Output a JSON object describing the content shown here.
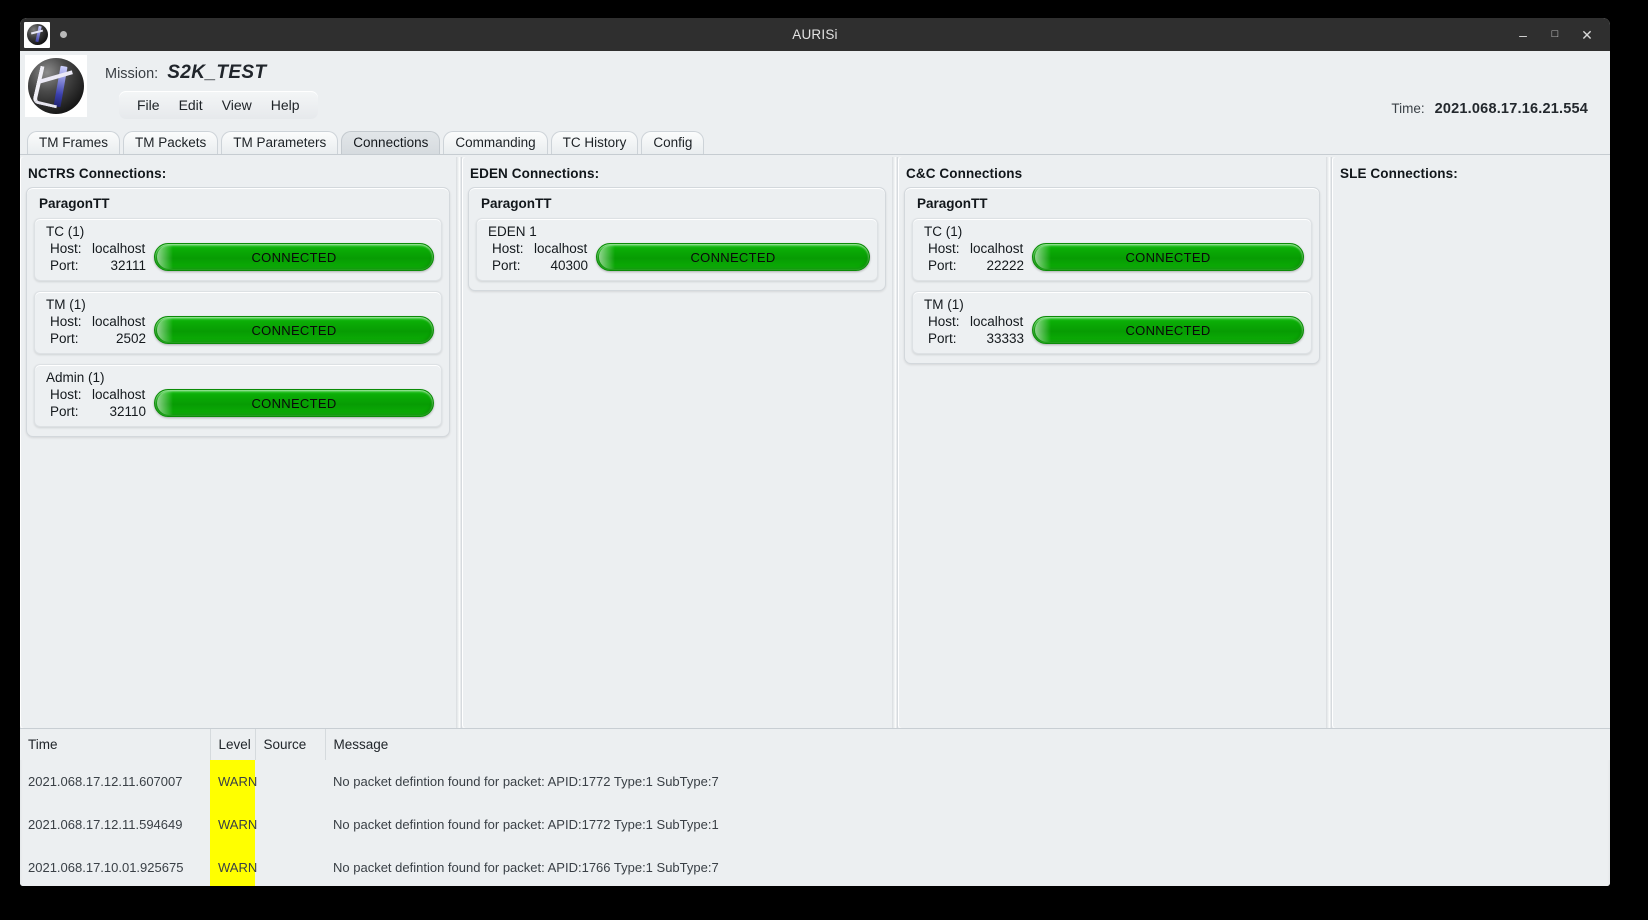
{
  "window": {
    "title": "AURISi",
    "minimize_icon": "minimize-icon",
    "maximize_icon": "maximize-icon",
    "close_icon": "close-icon",
    "minimize_glyph": "–",
    "maximize_glyph": "□",
    "close_glyph": "✕"
  },
  "header": {
    "mission_label": "Mission:",
    "mission_value": "S2K_TEST",
    "time_label": "Time:",
    "time_value": "2021.068.17.16.21.554",
    "menu": [
      {
        "label": "File"
      },
      {
        "label": "Edit"
      },
      {
        "label": "View"
      },
      {
        "label": "Help"
      }
    ]
  },
  "tabs": [
    {
      "label": "TM Frames",
      "active": false
    },
    {
      "label": "TM Packets",
      "active": false
    },
    {
      "label": "TM Parameters",
      "active": false
    },
    {
      "label": "Connections",
      "active": true
    },
    {
      "label": "Commanding",
      "active": false
    },
    {
      "label": "TC History",
      "active": false
    },
    {
      "label": "Config",
      "active": false
    }
  ],
  "panels": {
    "nctrs": {
      "title": "NCTRS Connections:",
      "group": "ParagonTT",
      "connections": [
        {
          "name": "TC (1)",
          "host_label": "Host:",
          "host": "localhost",
          "port_label": "Port:",
          "port": "32111",
          "status": "CONNECTED"
        },
        {
          "name": "TM (1)",
          "host_label": "Host:",
          "host": "localhost",
          "port_label": "Port:",
          "port": "2502",
          "status": "CONNECTED"
        },
        {
          "name": "Admin (1)",
          "host_label": "Host:",
          "host": "localhost",
          "port_label": "Port:",
          "port": "32110",
          "status": "CONNECTED"
        }
      ]
    },
    "eden": {
      "title": "EDEN Connections:",
      "group": "ParagonTT",
      "connections": [
        {
          "name": "EDEN 1",
          "host_label": "Host:",
          "host": "localhost",
          "port_label": "Port:",
          "port": "40300",
          "status": "CONNECTED"
        }
      ]
    },
    "cnc": {
      "title": "C&C Connections",
      "group": "ParagonTT",
      "connections": [
        {
          "name": "TC (1)",
          "host_label": "Host:",
          "host": "localhost",
          "port_label": "Port:",
          "port": "22222",
          "status": "CONNECTED"
        },
        {
          "name": "TM (1)",
          "host_label": "Host:",
          "host": "localhost",
          "port_label": "Port:",
          "port": "33333",
          "status": "CONNECTED"
        }
      ]
    },
    "sle": {
      "title": "SLE Connections:",
      "connections": []
    }
  },
  "log": {
    "columns": [
      "Time",
      "Level",
      "Source",
      "Message"
    ],
    "rows": [
      {
        "time": "2021.068.17.12.11.607007",
        "level": "WARN",
        "source": "",
        "message": "No packet defintion found for packet: APID:1772 Type:1 SubType:7"
      },
      {
        "time": "2021.068.17.12.11.594649",
        "level": "WARN",
        "source": "",
        "message": "No packet defintion found for packet: APID:1772 Type:1 SubType:1"
      },
      {
        "time": "2021.068.17.10.01.925675",
        "level": "WARN",
        "source": "",
        "message": "No packet defintion found for packet: APID:1766 Type:1 SubType:7"
      }
    ]
  },
  "colors": {
    "status_connected": "#0aa805",
    "warn_background": "#ffff00",
    "window_background": "#eceff1",
    "titlebar": "#2f2f2f"
  }
}
